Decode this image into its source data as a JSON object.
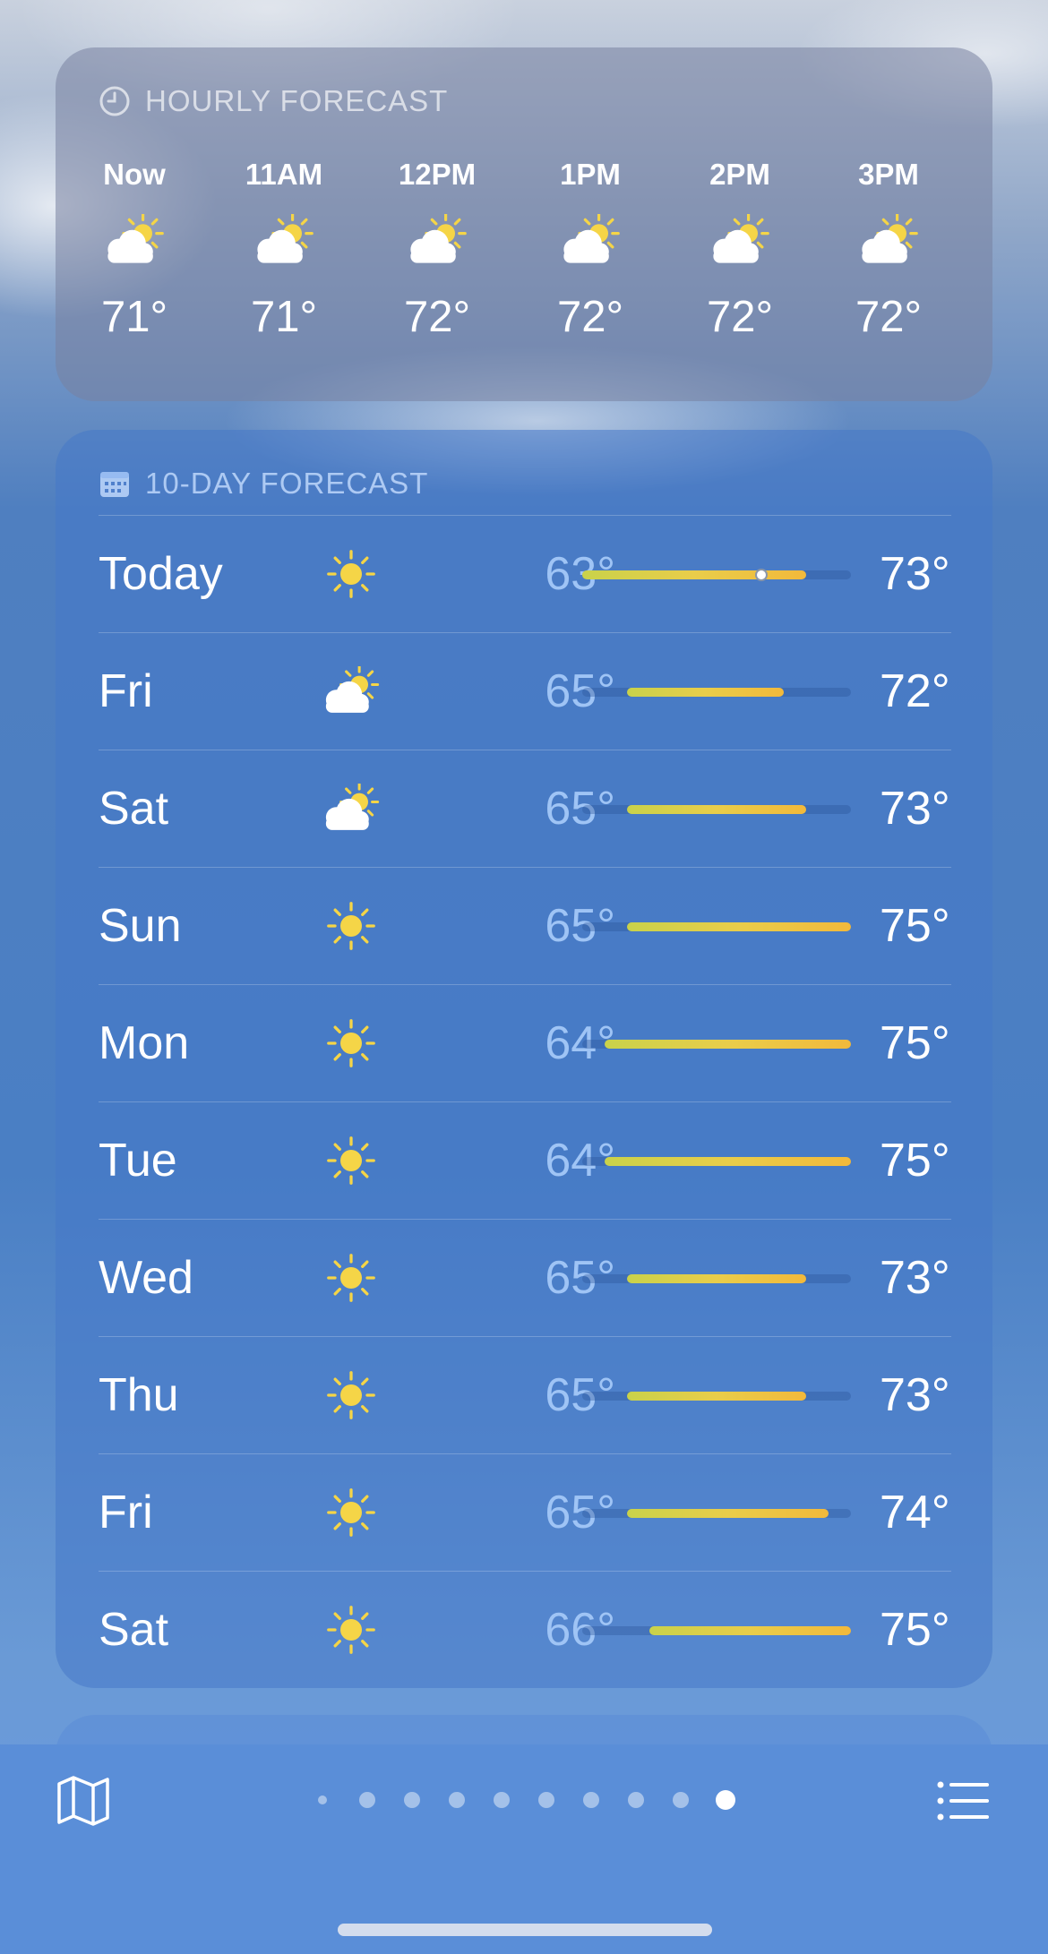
{
  "hourly": {
    "title": "HOURLY FORECAST",
    "icon": "clock-icon",
    "hours": [
      {
        "time": "Now",
        "temp": "71°",
        "icon": "partly-cloudy-icon"
      },
      {
        "time": "11AM",
        "temp": "71°",
        "icon": "partly-cloudy-icon"
      },
      {
        "time": "12PM",
        "temp": "72°",
        "icon": "partly-cloudy-icon"
      },
      {
        "time": "1PM",
        "temp": "72°",
        "icon": "partly-cloudy-icon"
      },
      {
        "time": "2PM",
        "temp": "72°",
        "icon": "partly-cloudy-icon"
      },
      {
        "time": "3PM",
        "temp": "72°",
        "icon": "partly-cloudy-icon"
      }
    ]
  },
  "daily": {
    "title": "10-DAY FORECAST",
    "icon": "calendar-icon",
    "range_low": 63,
    "range_high": 75,
    "current_temp": 71,
    "days": [
      {
        "day": "Today",
        "low": "63°",
        "high": "73°",
        "low_val": 63,
        "high_val": 73,
        "icon": "sun-icon"
      },
      {
        "day": "Fri",
        "low": "65°",
        "high": "72°",
        "low_val": 65,
        "high_val": 72,
        "icon": "partly-cloudy-icon"
      },
      {
        "day": "Sat",
        "low": "65°",
        "high": "73°",
        "low_val": 65,
        "high_val": 73,
        "icon": "partly-cloudy-icon"
      },
      {
        "day": "Sun",
        "low": "65°",
        "high": "75°",
        "low_val": 65,
        "high_val": 75,
        "icon": "sun-icon"
      },
      {
        "day": "Mon",
        "low": "64°",
        "high": "75°",
        "low_val": 64,
        "high_val": 75,
        "icon": "sun-icon"
      },
      {
        "day": "Tue",
        "low": "64°",
        "high": "75°",
        "low_val": 64,
        "high_val": 75,
        "icon": "sun-icon"
      },
      {
        "day": "Wed",
        "low": "65°",
        "high": "73°",
        "low_val": 65,
        "high_val": 73,
        "icon": "sun-icon"
      },
      {
        "day": "Thu",
        "low": "65°",
        "high": "73°",
        "low_val": 65,
        "high_val": 73,
        "icon": "sun-icon"
      },
      {
        "day": "Fri",
        "low": "65°",
        "high": "74°",
        "low_val": 65,
        "high_val": 74,
        "icon": "sun-icon"
      },
      {
        "day": "Sat",
        "low": "66°",
        "high": "75°",
        "low_val": 66,
        "high_val": 75,
        "icon": "sun-icon"
      }
    ]
  },
  "bottom_bar": {
    "map_icon": "map-icon",
    "list_icon": "list-icon",
    "location_icon": "location-arrow-icon",
    "page_count": 10,
    "active_page": 10
  },
  "colors": {
    "sun": "#f5d547",
    "bar_start": "#c9d24a",
    "bar_end": "#f2b93b",
    "low_temp": "#9fc4f5"
  }
}
